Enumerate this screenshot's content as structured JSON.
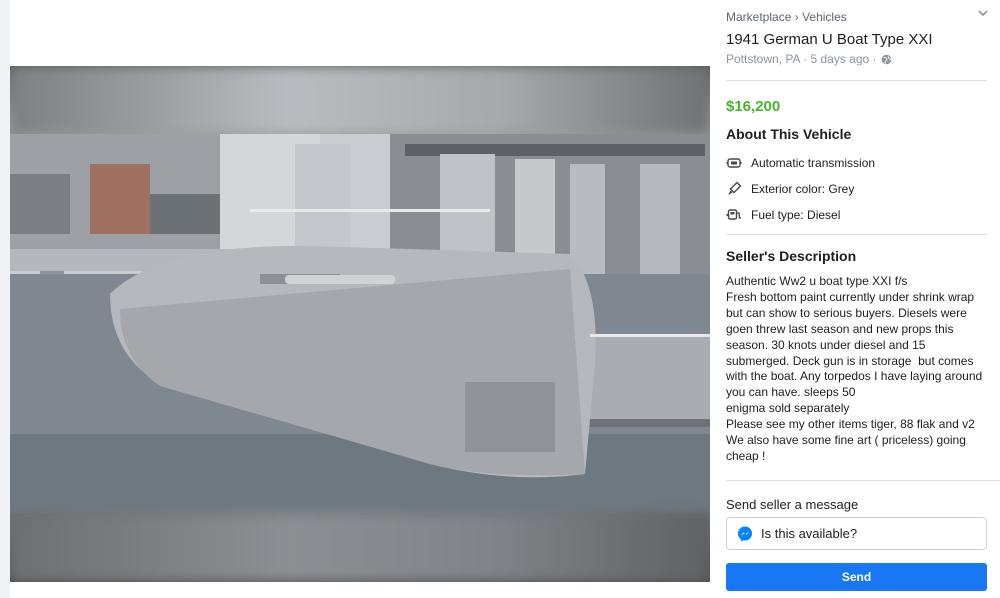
{
  "breadcrumb": {
    "root": "Marketplace",
    "separator": "›",
    "section": "Vehicles"
  },
  "listing": {
    "title": "1941 German U Boat Type XXI",
    "location_time": "Pottstown, PA · 5 days ago ·",
    "price": "$16,200"
  },
  "about": {
    "heading": "About This Vehicle",
    "items": [
      {
        "icon": "gearbox-icon",
        "label": "Automatic transmission"
      },
      {
        "icon": "paint-brush-icon",
        "label": "Exterior color: Grey"
      },
      {
        "icon": "fuel-pump-icon",
        "label": "Fuel type: Diesel"
      }
    ]
  },
  "seller": {
    "heading": "Seller's Description",
    "lines": [
      "Authentic Ww2 u boat type XXI f/s",
      "Fresh bottom paint currently under shrink wrap",
      "but can show to serious buyers. Diesels were",
      "goen threw last season and new props this",
      "season. 30 knots under diesel and 15",
      "submerged. Deck gun is in storage  but comes",
      "with the boat. Any torpedos I have laying around",
      "you can have. sleeps 50",
      "enigma sold separately",
      "Please see my other items tiger, 88 flak and v2",
      "We also have some fine art ( priceless) going",
      "cheap !"
    ]
  },
  "message": {
    "label": "Send seller a message",
    "input_value": "Is this available?",
    "send_label": "Send"
  },
  "colors": {
    "price": "#42b72a",
    "send_button": "#1877f2",
    "messenger": "#0084ff"
  }
}
